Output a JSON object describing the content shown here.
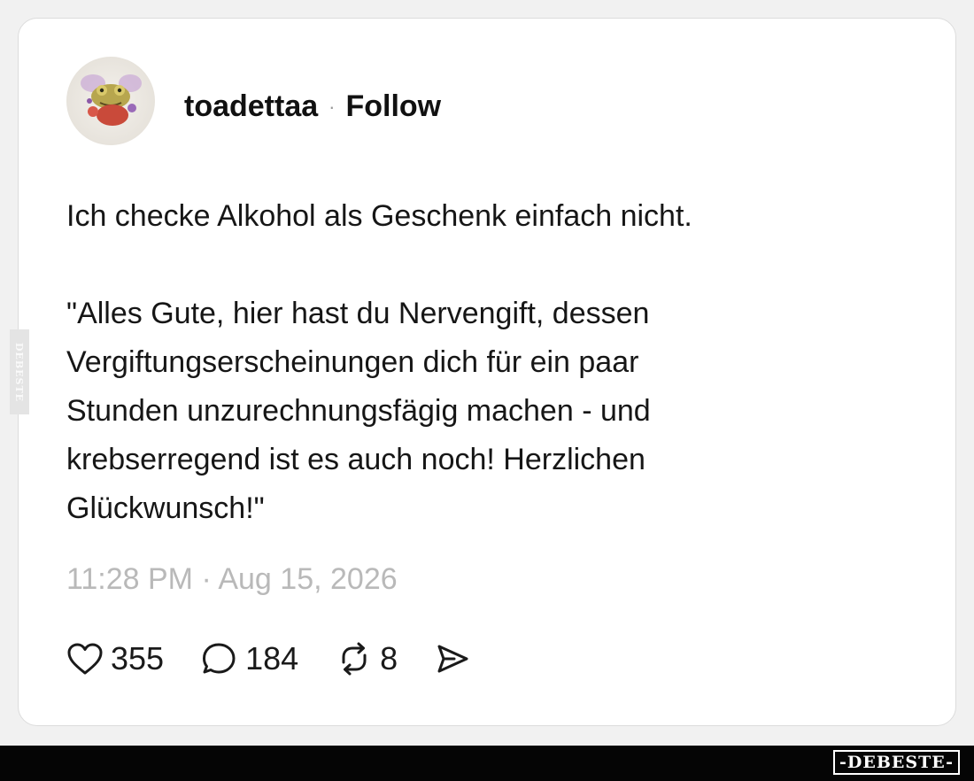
{
  "post": {
    "username": "toadettaa",
    "separator": "·",
    "follow_label": "Follow",
    "text": "Ich checke Alkohol als Geschenk einfach nicht.\n\n\"Alles Gute, hier hast du Nervengift, dessen\nVergiftungserscheinungen dich für ein paar\nStunden unzurechnungsfägig machen - und\nkrebserregend ist es auch noch! Herzlichen\nGlückwunsch!\"",
    "timestamp": "11:28 PM · Aug 15, 2026"
  },
  "actions": {
    "likes": "355",
    "comments": "184",
    "reposts": "8",
    "icons": [
      "heart-icon",
      "comment-icon",
      "repost-icon",
      "share-icon"
    ]
  },
  "watermark": {
    "side_text": "DEBESTE",
    "brand": "-DEBESTE-"
  },
  "colors": {
    "card_bg": "#ffffff",
    "page_bg": "#f1f1f1",
    "timestamp": "#b9b9b9",
    "bar": "#050505"
  }
}
